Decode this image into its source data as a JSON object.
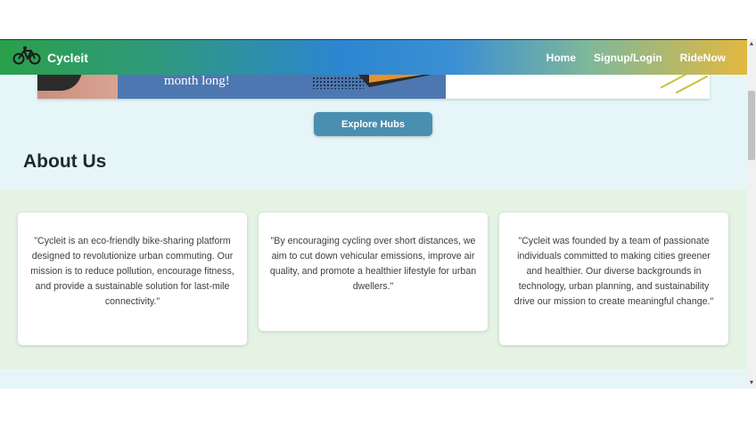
{
  "navbar": {
    "brand_name": "Cycleit",
    "links": [
      {
        "label": "Home"
      },
      {
        "label": "Signup/Login"
      },
      {
        "label": "RideNow"
      }
    ]
  },
  "banner": {
    "text": "month long!"
  },
  "explore_button": {
    "label": "Explore Hubs"
  },
  "about": {
    "title": "About Us",
    "cards": [
      {
        "text": "\"Cycleit is an eco-friendly bike-sharing platform designed to revolutionize urban commuting. Our mission is to reduce pollution, encourage fitness, and provide a sustainable solution for last-mile connectivity.\""
      },
      {
        "text": "\"By encouraging cycling over short distances, we aim to cut down vehicular emissions, improve air quality, and promote a healthier lifestyle for urban dwellers.\""
      },
      {
        "text": "\"Cycleit was founded by a team of passionate individuals committed to making cities greener and healthier. Our diverse backgrounds in technology, urban planning, and sustainability drive our mission to create meaningful change.\""
      }
    ]
  },
  "icons": {
    "brand": "bicycle-icon",
    "scroll_up": "arrow-up-icon",
    "scroll_down": "arrow-down-icon"
  },
  "colors": {
    "nav_gradient_start": "#2aa04a",
    "nav_gradient_mid": "#2c86d0",
    "nav_gradient_end": "#e8b83a",
    "button": "#4a8fb0",
    "about_bg": "#e4f3e4",
    "page_bg": "#e6f6f8"
  }
}
